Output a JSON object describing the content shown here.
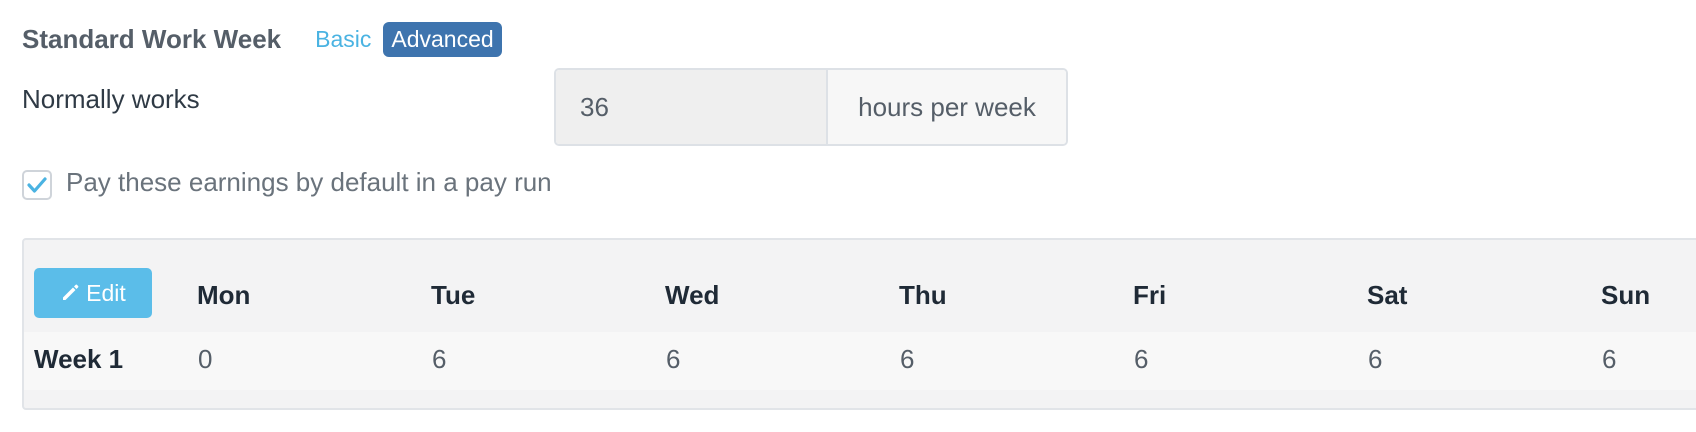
{
  "header": {
    "title": "Standard Work Week",
    "mode_basic": "Basic",
    "mode_advanced": "Advanced"
  },
  "hours": {
    "label": "Normally works",
    "value": "36",
    "suffix": "hours per week"
  },
  "default_pay": {
    "checked": true,
    "label": "Pay these earnings by default in a pay run"
  },
  "week_table": {
    "edit_label": "Edit",
    "days": [
      "Mon",
      "Tue",
      "Wed",
      "Thu",
      "Fri",
      "Sat",
      "Sun"
    ],
    "rows": [
      {
        "label": "Week 1",
        "values": [
          "0",
          "6",
          "6",
          "6",
          "6",
          "6",
          "6"
        ]
      }
    ]
  },
  "colors": {
    "accent": "#4ab3e2",
    "advanced_bg": "#3e74ae",
    "edit_bg": "#5bbde9"
  }
}
